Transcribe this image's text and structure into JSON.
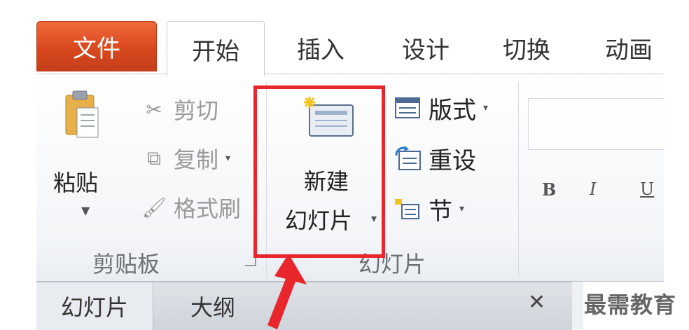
{
  "tabs": {
    "file": "文件",
    "home": "开始",
    "insert": "插入",
    "design": "设计",
    "transitions": "切换",
    "animations": "动画"
  },
  "clipboard": {
    "paste": "粘贴",
    "cut": "剪切",
    "copy": "复制",
    "format_painter": "格式刷",
    "group_label": "剪贴板"
  },
  "slides": {
    "new_slide_line1": "新建",
    "new_slide_line2": "幻灯片",
    "layout": "版式",
    "reset": "重设",
    "section": "节",
    "group_label": "幻灯片"
  },
  "font": {
    "bold": "B",
    "italic": "I",
    "underline": "U"
  },
  "panel": {
    "slides_tab": "幻灯片",
    "outline_tab": "大纲",
    "close": "✕"
  },
  "watermark": "最需教育",
  "colors": {
    "file_tab": "#d9481f",
    "highlight": "#e8262c"
  }
}
